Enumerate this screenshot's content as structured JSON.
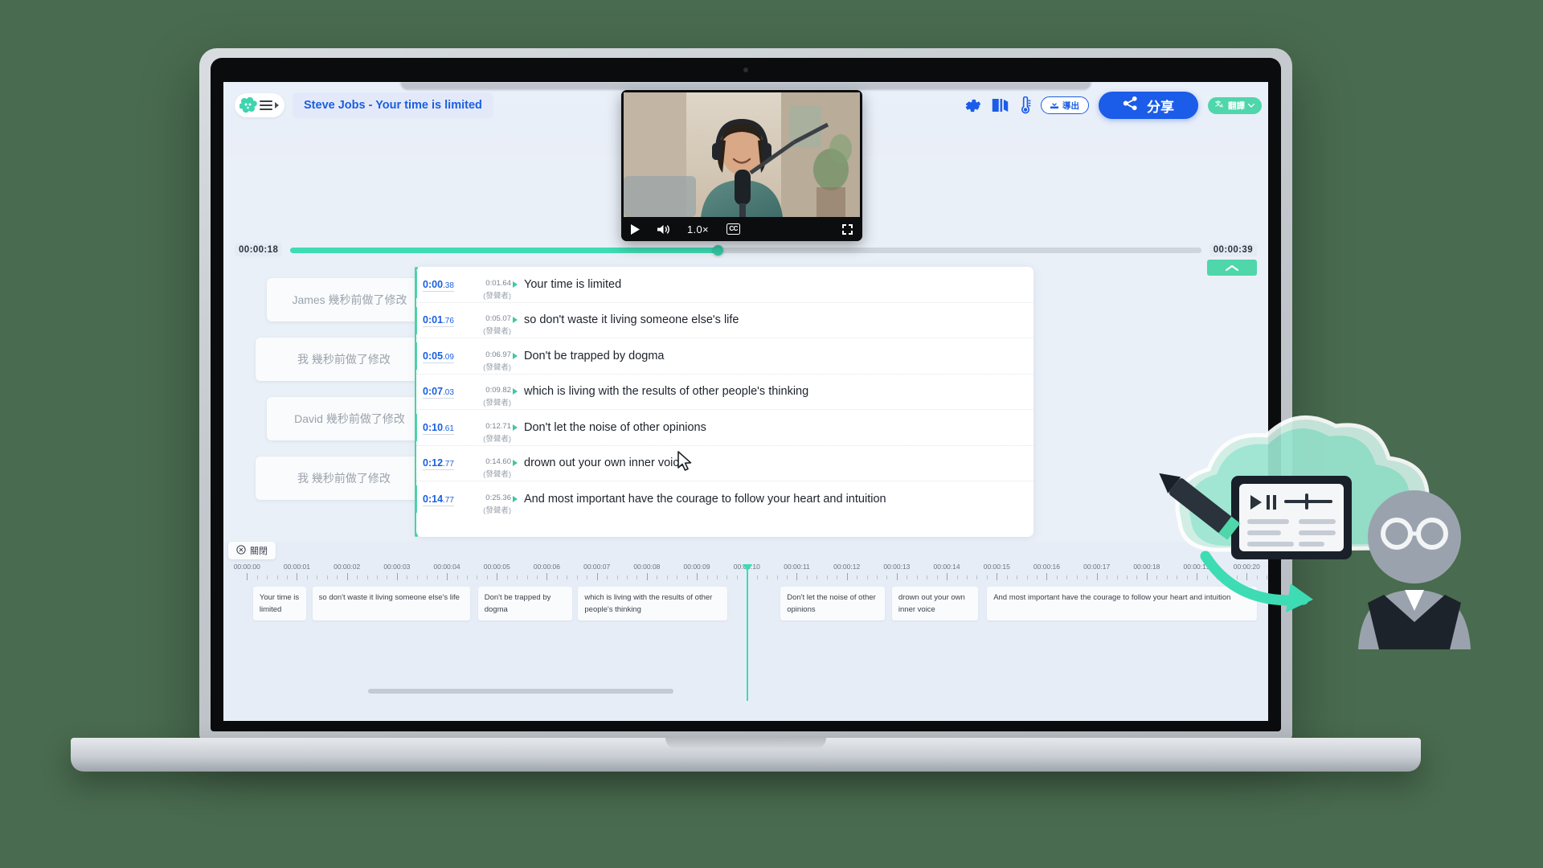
{
  "app": {
    "brand_logo": "flower-logo-icon",
    "menu_icon": "hamburger-icon",
    "expand_icon": "chevron-right-icon",
    "document_title": "Steve Jobs - Your time is limited"
  },
  "toolbar": {
    "settings_icon": "gear-icon",
    "dictionary_icon": "book-icon",
    "thermometer_icon": "thermometer-icon",
    "export_label": "導出",
    "export_icon": "download-icon",
    "share_label": "分享",
    "share_icon": "share-nodes-icon",
    "translate_label": "翻譯",
    "translate_icon": "translate-icon",
    "translate_chevron": "chevron-down-icon",
    "accent_blue": "#1b5ce8",
    "accent_teal": "#4fd6ab"
  },
  "video": {
    "play_icon": "play-icon",
    "volume_icon": "volume-icon",
    "speed_label": "1.0×",
    "cc_label": "CC",
    "fullscreen_icon": "fullscreen-icon"
  },
  "progress": {
    "current_time": "00:00:18",
    "total_time": "00:00:39",
    "percent": 47,
    "fill_color": "#3ddcb4",
    "collapse_icon": "chevron-up-icon"
  },
  "edit_cards": [
    {
      "text": "James 幾秒前做了修改"
    },
    {
      "text": "我 幾秒前做了修改"
    },
    {
      "text": "David 幾秒前做了修改"
    },
    {
      "text": "我 幾秒前做了修改"
    }
  ],
  "transcript": {
    "speaker_label": "(發聲者)",
    "rows": [
      {
        "start": "0:00",
        "start_frac": ".38",
        "end": "0:01.64",
        "text": "Your time is limited",
        "active": true
      },
      {
        "start": "0:01",
        "start_frac": ".76",
        "end": "0:05.07",
        "text": "so don't waste it living someone else's life",
        "active": true
      },
      {
        "start": "0:05",
        "start_frac": ".09",
        "end": "0:06.97",
        "text": "Don't be trapped by dogma",
        "active": true
      },
      {
        "start": "0:07",
        "start_frac": ".03",
        "end": "0:09.82",
        "text": "which is living with the results of other people's thinking",
        "active": false
      },
      {
        "start": "0:10",
        "start_frac": ".61",
        "end": "0:12.71",
        "text": "Don't let the noise of other opinions",
        "active": true
      },
      {
        "start": "0:12",
        "start_frac": ".77",
        "end": "0:14.60",
        "text": "drown out your own inner voice",
        "active": false
      },
      {
        "start": "0:14",
        "start_frac": ".77",
        "end": "0:25.36",
        "text": "And most important have the courage to follow your heart and intuition",
        "active": true
      }
    ]
  },
  "timeline": {
    "close_label": "關閉",
    "close_icon": "circle-x-icon",
    "playhead_time": "00:00:10",
    "playhead_percent": 50,
    "ruler_ticks": [
      "00:00:00",
      "00:00:01",
      "00:00:02",
      "00:00:03",
      "00:00:04",
      "00:00:05",
      "00:00:06",
      "00:00:07",
      "00:00:08",
      "00:00:09",
      "00:00:10",
      "00:00:11",
      "00:00:12",
      "00:00:13",
      "00:00:14",
      "00:00:15",
      "00:00:16",
      "00:00:17",
      "00:00:18",
      "00:00:19",
      "00:00:20"
    ],
    "caption_blocks": [
      {
        "text": "Your time is limited",
        "left_pct": 1.8,
        "width_pct": 5.2
      },
      {
        "text": "so don't waste it living someone else's life",
        "left_pct": 7.6,
        "width_pct": 15.4
      },
      {
        "text": "Don't be trapped by dogma",
        "left_pct": 23.8,
        "width_pct": 9.2
      },
      {
        "text": "which is living with the results of other people's thinking",
        "left_pct": 33.6,
        "width_pct": 14.6
      },
      {
        "text": "Don't let the noise of other opinions",
        "left_pct": 53.4,
        "width_pct": 10.2
      },
      {
        "text": "drown out your own inner voice",
        "left_pct": 64.3,
        "width_pct": 8.4
      },
      {
        "text": "And most important have the courage to follow your heart and intuition",
        "left_pct": 73.6,
        "width_pct": 26.4
      }
    ]
  }
}
